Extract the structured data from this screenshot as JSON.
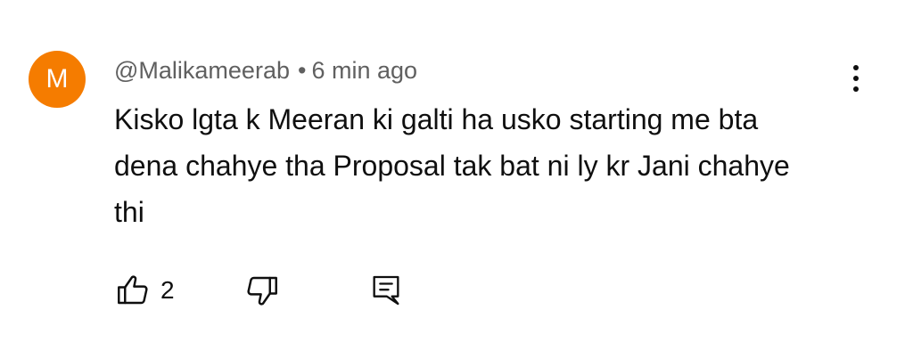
{
  "comment": {
    "avatar_initial": "M",
    "avatar_color": "#f57c00",
    "author": "@Malikameerab",
    "separator": "•",
    "time_ago": "6 min ago",
    "text": "Kisko lgta k Meeran ki galti ha usko starting me bta dena chahye tha Proposal tak bat ni ly kr Jani chahye thi",
    "menu_icon": "more-vertical-icon",
    "actions": {
      "like_icon": "thumbs-up-icon",
      "like_count": "2",
      "dislike_icon": "thumbs-down-icon",
      "reply_icon": "reply-comment-icon"
    }
  }
}
